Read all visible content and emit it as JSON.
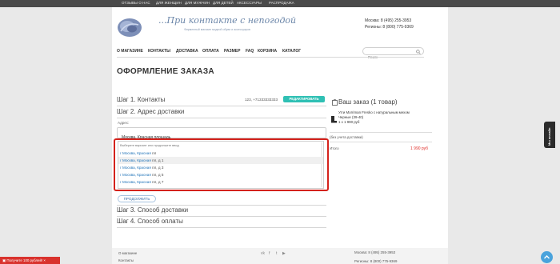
{
  "topbar": {
    "items": [
      "ОТЗЫВЫ О НАС",
      "ДЛЯ ЖЕНЩИН",
      "ДЛЯ МУЖЧИН",
      "ДЛЯ ДЕТЕЙ",
      "АКСЕССУАРЫ",
      "РАСПРОДАЖА"
    ]
  },
  "header": {
    "logo_script": "...При контакте с непогодой",
    "logo_tagline": "Фирменный магазин модной обуви и аксессуаров",
    "phone_moscow": "Москва: 8 (495) 255-3953",
    "phone_regions": "Регионы: 8 (800) 775-9369"
  },
  "nav": {
    "items": [
      "О МАГАЗИНЕ",
      "КОНТАКТЫ",
      "ДОСТАВКА",
      "ОПЛАТА",
      "РАЗМЕР",
      "FAQ",
      "КОРЗИНА",
      "КАТАЛОГ"
    ],
    "search_placeholder": "Поиск"
  },
  "page_title": "ОФОРМЛЕНИЕ ЗАКАЗА",
  "steps": {
    "step1": "Шаг 1. Контакты",
    "step1_contact": "123, +71333333333",
    "step1_edit": "РЕДАКТИРОВАТЬ",
    "step2": "Шаг 2. Адрес доставки",
    "address_label": "Адрес:",
    "address_value": "Москва, Красная площадь",
    "step3": "Шаг 3. Способ доставки",
    "step4": "Шаг 4. Способ оплаты",
    "continue": "ПРОДОЛЖИТЬ"
  },
  "suggestions": {
    "hint": "Выберите вариант или продолжите ввод",
    "items": [
      {
        "hl": "г Москва, Красная",
        "rest": " пл"
      },
      {
        "hl": "г Москва, Красная",
        "rest": " пл, д 1"
      },
      {
        "hl": "г Москва, Красная",
        "rest": " пл, д 3"
      },
      {
        "hl": "г Москва, Красная",
        "rest": " пл, д 5"
      },
      {
        "hl": "г Москва, Красная",
        "rest": " пл, д 7"
      }
    ]
  },
  "cart": {
    "title": "Ваш заказ (1 товар)",
    "product_line1": "Угги Morriman Fresko с натуральным мехом",
    "product_line2": "Черные (39-40)",
    "product_line3": "1 x 1 990 руб",
    "delivery_note": "(без учета доставки)",
    "total_label": "Итого",
    "total_value": "1 990 руб"
  },
  "footer": {
    "links": [
      "О магазине",
      "Контакты"
    ],
    "phone_moscow": "Москва: 8 (495) 255-3953",
    "phone_regions": "Регионы: 8 (800) 775-9369",
    "social": [
      "vk",
      "f",
      "t",
      "yt"
    ]
  },
  "side_tab": "Мы онлайн",
  "gift_bar": "Получите 100 рублей!",
  "colors": {
    "accent_teal": "#2fc0b4",
    "highlight_red": "#d4221c",
    "price_red": "#e0302b",
    "link_blue": "#1e72b8"
  }
}
